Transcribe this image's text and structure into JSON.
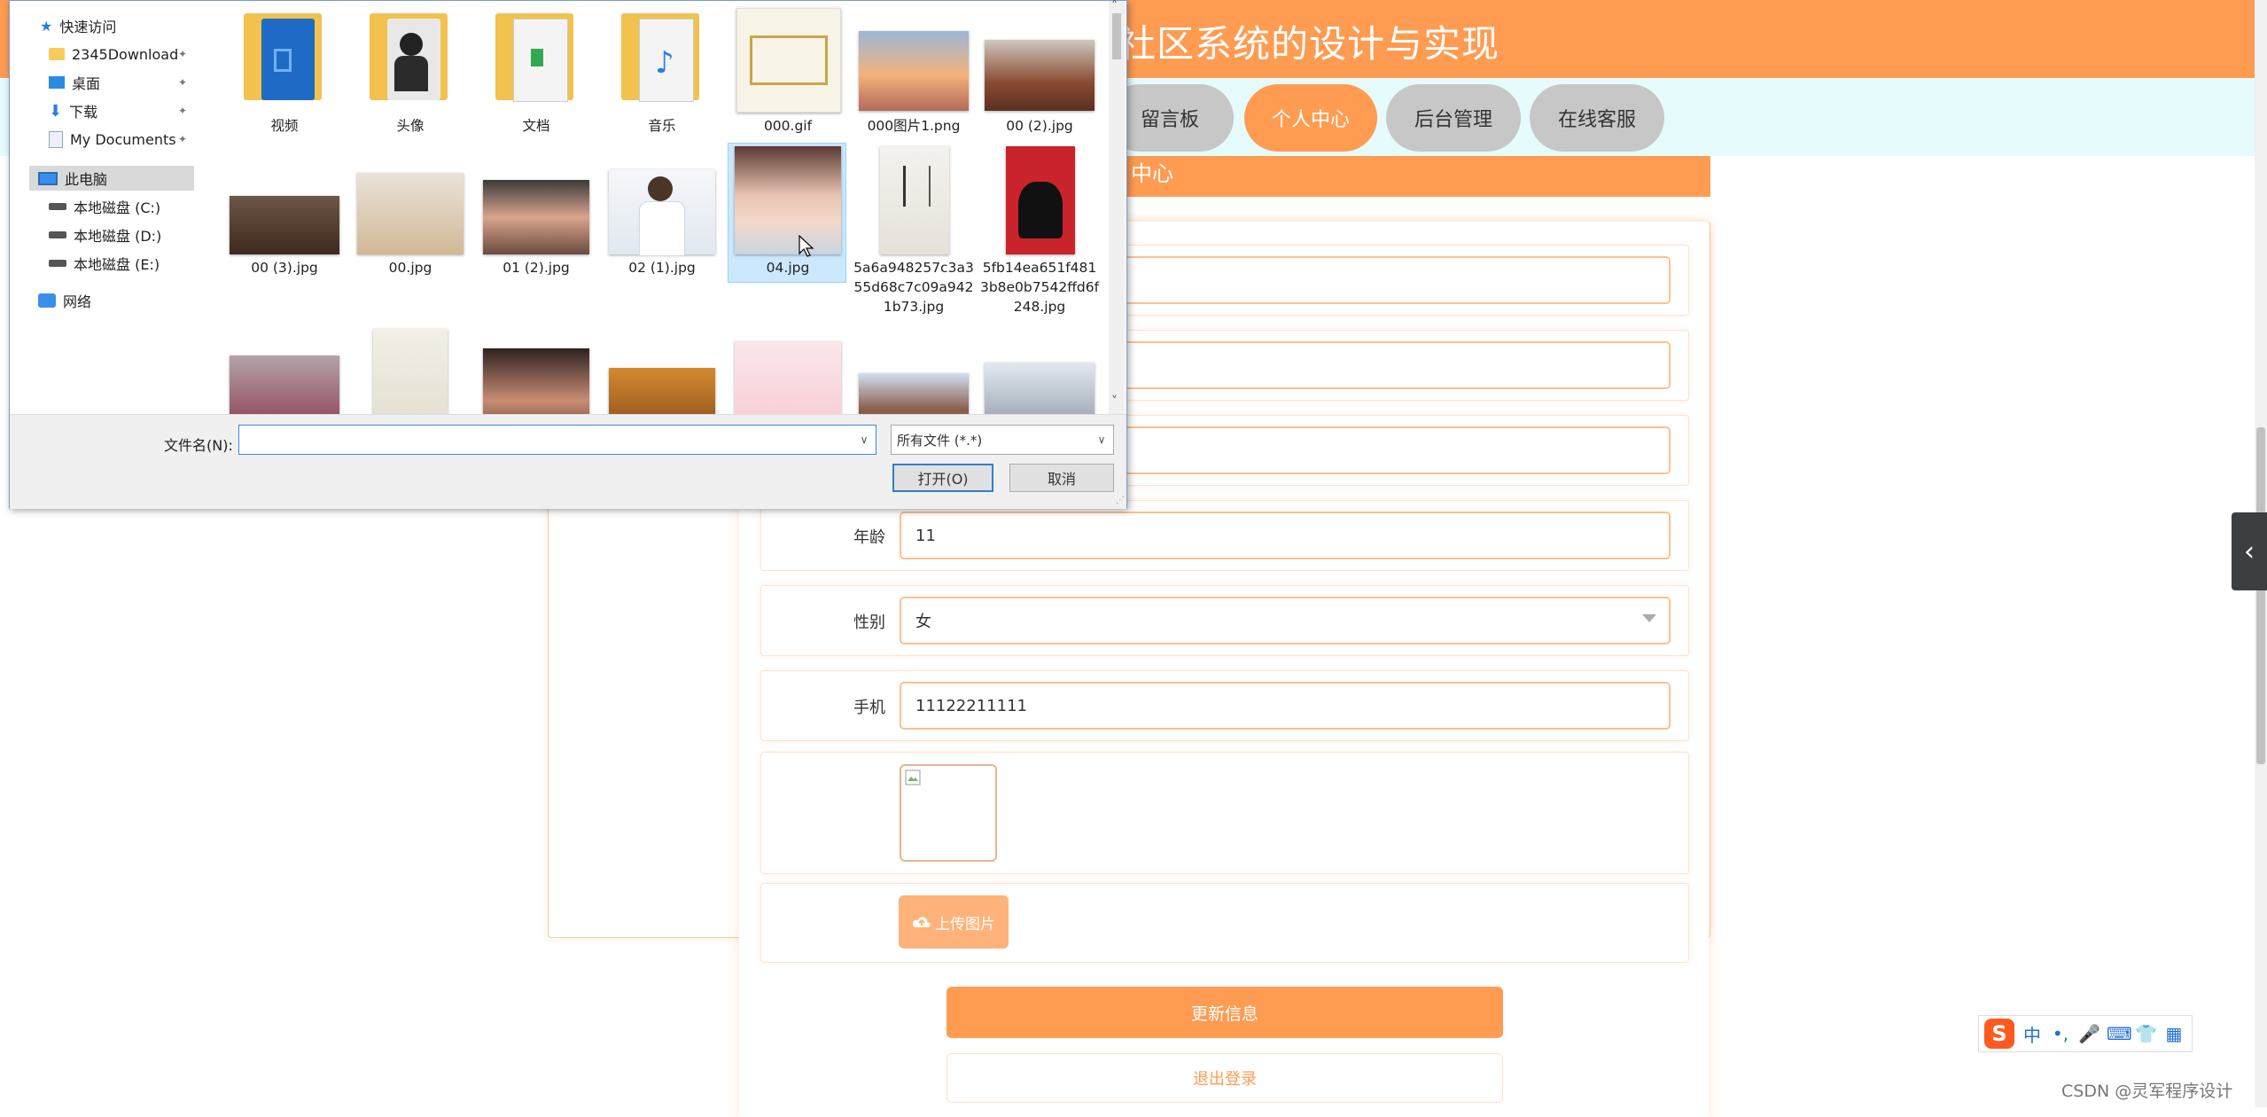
{
  "site": {
    "title": "社区系统的设计与实现",
    "nav": [
      "留言板",
      "个人中心",
      "后台管理",
      "在线客服"
    ],
    "active_nav": "个人中心",
    "section_title": "中心"
  },
  "form": {
    "rows": [
      {
        "label": "",
        "value": ""
      },
      {
        "label": "",
        "value": ""
      },
      {
        "label": "",
        "value": ""
      },
      {
        "label": "年龄",
        "value": "11"
      },
      {
        "label": "性别",
        "value": "女"
      },
      {
        "label": "手机",
        "value": "11122211111"
      }
    ],
    "upload_label": "上传图片",
    "update_label": "更新信息",
    "logout_label": "退出登录"
  },
  "dialog": {
    "nav": [
      {
        "label": "快速访问",
        "icon": "star-icon"
      },
      {
        "label": "2345Download",
        "icon": "folder-icon",
        "pinned": true
      },
      {
        "label": "桌面",
        "icon": "desktop-icon",
        "pinned": true
      },
      {
        "label": "下载",
        "icon": "download-icon",
        "pinned": true
      },
      {
        "label": "My Documents",
        "icon": "document-icon",
        "pinned": true
      },
      {
        "label": "此电脑",
        "icon": "computer-icon",
        "selected": true
      },
      {
        "label": "本地磁盘 (C:)",
        "icon": "drive-icon"
      },
      {
        "label": "本地磁盘 (D:)",
        "icon": "drive-icon"
      },
      {
        "label": "本地磁盘 (E:)",
        "icon": "drive-icon"
      },
      {
        "label": "网络",
        "icon": "network-icon"
      }
    ],
    "files": [
      {
        "name": "视频",
        "kind": "folder"
      },
      {
        "name": "头像",
        "kind": "folder"
      },
      {
        "name": "文档",
        "kind": "folder"
      },
      {
        "name": "音乐",
        "kind": "folder"
      },
      {
        "name": "000.gif",
        "kind": "image"
      },
      {
        "name": "000图片1.png",
        "kind": "image"
      },
      {
        "name": "00 (2).jpg",
        "kind": "image"
      },
      {
        "name": "00 (3).jpg",
        "kind": "image"
      },
      {
        "name": "00.jpg",
        "kind": "image"
      },
      {
        "name": "01 (2).jpg",
        "kind": "image"
      },
      {
        "name": "02 (1).jpg",
        "kind": "image"
      },
      {
        "name": "04.jpg",
        "kind": "image",
        "selected": true
      },
      {
        "name": "5a6a948257c3a355d68c7c09a9421b73.jpg",
        "kind": "image"
      },
      {
        "name": "5fb14ea651f4813b8e0b7542ffd6f248.jpg",
        "kind": "image"
      },
      {
        "name": "",
        "kind": "image"
      },
      {
        "name": "",
        "kind": "image"
      },
      {
        "name": "",
        "kind": "image"
      },
      {
        "name": "",
        "kind": "image"
      },
      {
        "name": "",
        "kind": "image"
      },
      {
        "name": "",
        "kind": "image"
      },
      {
        "name": "",
        "kind": "image"
      }
    ],
    "filename_label": "文件名(N):",
    "filename_value": "",
    "filetype_value": "所有文件 (*.*)",
    "open_label": "打开(O)",
    "cancel_label": "取消"
  },
  "ime": {
    "items": [
      "中",
      "•,",
      "🎤",
      "⌨",
      "👕",
      "▦"
    ]
  },
  "watermark": "CSDN @灵军程序设计",
  "colors": {
    "accent": "#ff9c52",
    "nav_bg": "#e6fbfb",
    "nav_btn": "#c7c7c7",
    "selection": "#cce8ff"
  }
}
